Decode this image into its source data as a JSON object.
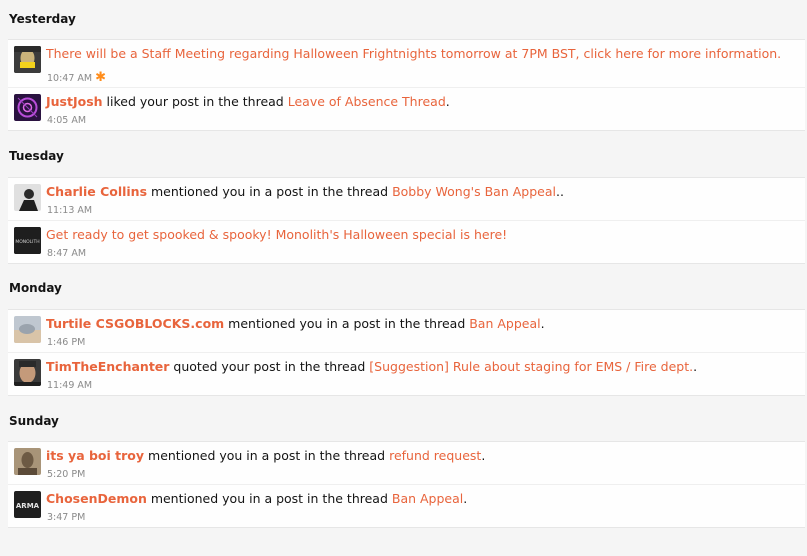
{
  "sections": {
    "yesterday": "Yesterday",
    "tuesday": "Tuesday",
    "monday": "Monday",
    "sunday": "Sunday"
  },
  "items": [
    {
      "link_text": "There will be a Staff Meeting regarding Halloween Frightnights tomorrow at 7PM BST, click here for more information.",
      "time": "10:47 AM",
      "star": "✱"
    },
    {
      "user": "JustJosh",
      "action": " liked your post in the thread ",
      "thread": "Leave of Absence Thread",
      "end": ".",
      "time": "4:05 AM"
    },
    {
      "user": "Charlie Collins",
      "action": " mentioned you in a post in the thread ",
      "thread": "Bobby Wong's Ban Appeal",
      "end": "..",
      "time": "11:13 AM"
    },
    {
      "link_text": "Get ready to get spooked & spooky! Monolith's Halloween special is here!",
      "time": "8:47 AM",
      "avatar_text": "MONOLITH"
    },
    {
      "user": "Turtile CSGOBLOCKS.com",
      "action": " mentioned you in a post in the thread ",
      "thread": "Ban Appeal",
      "end": ".",
      "time": "1:46 PM"
    },
    {
      "user": "TimTheEnchanter",
      "action": " quoted your post in the thread ",
      "thread": "[Suggestion] Rule about staging for EMS / Fire dept.",
      "end": ".",
      "time": "11:49 AM"
    },
    {
      "user": "its ya boi troy",
      "action": " mentioned you in a post in the thread ",
      "thread": "refund request",
      "end": ".",
      "time": "5:20 PM"
    },
    {
      "user": "ChosenDemon",
      "action": " mentioned you in a post in the thread ",
      "thread": "Ban Appeal",
      "end": ".",
      "time": "3:47 PM",
      "avatar_text": "ARMA"
    }
  ],
  "colors": {
    "accent": "#e8643c",
    "star": "#ff8c1a",
    "time": "#8a8a8a"
  }
}
